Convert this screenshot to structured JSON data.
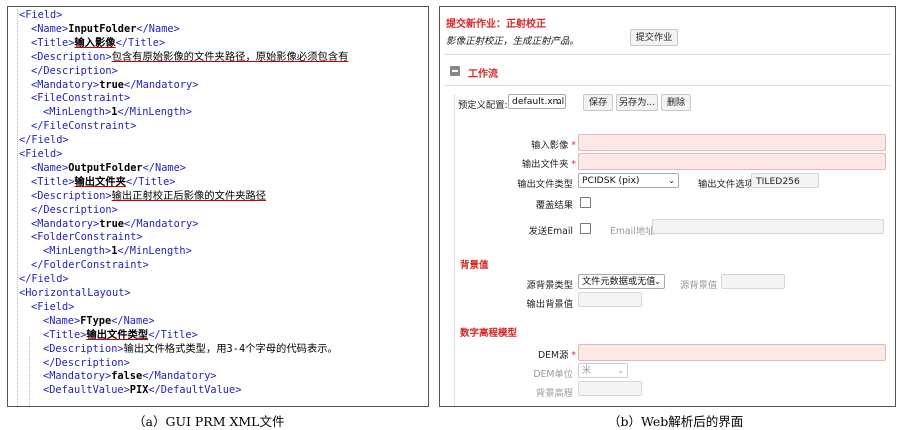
{
  "xml": {
    "lines": [
      {
        "indent": 0,
        "parts": [
          {
            "c": "tag",
            "t": "<Field>"
          }
        ]
      },
      {
        "indent": 1,
        "parts": [
          {
            "c": "tag",
            "t": "<Name>"
          },
          {
            "c": "val",
            "t": "InputFolder"
          },
          {
            "c": "tag",
            "t": "</Name>"
          }
        ]
      },
      {
        "indent": 1,
        "parts": [
          {
            "c": "tag",
            "t": "<Title>"
          },
          {
            "c": "val ul",
            "t": "输入影像"
          },
          {
            "c": "tag",
            "t": "</Title>"
          }
        ]
      },
      {
        "indent": 1,
        "parts": [
          {
            "c": "tag",
            "t": "<Description>"
          },
          {
            "c": "valn ul",
            "t": "包含有原始影像的文件夹路径，原始影像必须包含有"
          }
        ]
      },
      {
        "indent": 1,
        "parts": [
          {
            "c": "tag",
            "t": "</Description>"
          }
        ]
      },
      {
        "indent": 1,
        "parts": [
          {
            "c": "tag",
            "t": "<Mandatory>"
          },
          {
            "c": "val",
            "t": "true"
          },
          {
            "c": "tag",
            "t": "</Mandatory>"
          }
        ]
      },
      {
        "indent": 1,
        "parts": [
          {
            "c": "tag",
            "t": "<FileConstraint>"
          }
        ]
      },
      {
        "indent": 2,
        "parts": [
          {
            "c": "tag",
            "t": "<MinLength>"
          },
          {
            "c": "val",
            "t": "1"
          },
          {
            "c": "tag",
            "t": "</MinLength>"
          }
        ]
      },
      {
        "indent": 1,
        "parts": [
          {
            "c": "tag",
            "t": "</FileConstraint>"
          }
        ]
      },
      {
        "indent": 0,
        "parts": [
          {
            "c": "tag",
            "t": "</Field>"
          }
        ]
      },
      {
        "indent": 0,
        "parts": [
          {
            "c": "tag",
            "t": "<Field>"
          }
        ]
      },
      {
        "indent": 1,
        "parts": [
          {
            "c": "tag",
            "t": "<Name>"
          },
          {
            "c": "val",
            "t": "OutputFolder"
          },
          {
            "c": "tag",
            "t": "</Name>"
          }
        ]
      },
      {
        "indent": 1,
        "parts": [
          {
            "c": "tag",
            "t": "<Title>"
          },
          {
            "c": "val ul",
            "t": "输出文件夹"
          },
          {
            "c": "tag",
            "t": "</Title>"
          }
        ]
      },
      {
        "indent": 1,
        "parts": [
          {
            "c": "tag",
            "t": "<Description>"
          },
          {
            "c": "valn ul",
            "t": "输出正射校正后影像的文件夹路径"
          }
        ]
      },
      {
        "indent": 1,
        "parts": [
          {
            "c": "tag",
            "t": "</Description>"
          }
        ]
      },
      {
        "indent": 1,
        "parts": [
          {
            "c": "tag",
            "t": "<Mandatory>"
          },
          {
            "c": "val",
            "t": "true"
          },
          {
            "c": "tag",
            "t": "</Mandatory>"
          }
        ]
      },
      {
        "indent": 1,
        "parts": [
          {
            "c": "tag",
            "t": "<FolderConstraint>"
          }
        ]
      },
      {
        "indent": 2,
        "parts": [
          {
            "c": "tag",
            "t": "<MinLength>"
          },
          {
            "c": "val",
            "t": "1"
          },
          {
            "c": "tag",
            "t": "</MinLength>"
          }
        ]
      },
      {
        "indent": 1,
        "parts": [
          {
            "c": "tag",
            "t": "</FolderConstraint>"
          }
        ]
      },
      {
        "indent": 0,
        "parts": [
          {
            "c": "tag",
            "t": "</Field>"
          }
        ]
      },
      {
        "indent": 0,
        "parts": [
          {
            "c": "tag",
            "t": "<HorizontalLayout>"
          }
        ]
      },
      {
        "indent": 1,
        "parts": [
          {
            "c": "tag",
            "t": "<Field>"
          }
        ]
      },
      {
        "indent": 2,
        "parts": [
          {
            "c": "tag",
            "t": "<Name>"
          },
          {
            "c": "val",
            "t": "FType"
          },
          {
            "c": "tag",
            "t": "</Name>"
          }
        ]
      },
      {
        "indent": 2,
        "parts": [
          {
            "c": "tag",
            "t": "<Title>"
          },
          {
            "c": "val ul",
            "t": "输出文件类型"
          },
          {
            "c": "tag",
            "t": "</Title>"
          }
        ]
      },
      {
        "indent": 2,
        "parts": [
          {
            "c": "tag",
            "t": "<Description>"
          },
          {
            "c": "valn",
            "t": "输出文件格式类型，用3-4个字母的代码表示。"
          }
        ]
      },
      {
        "indent": 2,
        "parts": [
          {
            "c": "tag",
            "t": "</Description>"
          }
        ]
      },
      {
        "indent": 2,
        "parts": [
          {
            "c": "tag",
            "t": "<Mandatory>"
          },
          {
            "c": "val",
            "t": "false"
          },
          {
            "c": "tag",
            "t": "</Mandatory>"
          }
        ]
      },
      {
        "indent": 2,
        "parts": [
          {
            "c": "tag",
            "t": "<DefaultValue>"
          },
          {
            "c": "val",
            "t": "PIX"
          },
          {
            "c": "tag",
            "t": "</DefaultValue>"
          }
        ]
      }
    ]
  },
  "captions": {
    "left": "（a）GUI PRM XML文件",
    "right": "（b）Web解析后的界面"
  },
  "web": {
    "header_title": "提交新作业：正射校正",
    "header_desc": "影像正射校正，生成正射产品。",
    "submit_button": "提交作业",
    "workflow_section": "工作流",
    "collapse_icon": "minus-square-icon",
    "preset_label": "预定义配置:",
    "preset_value": "default.xml",
    "save_button": "保存",
    "save_as_button": "另存为...",
    "delete_button": "删除",
    "required_mark": "*",
    "fields": {
      "input_image_label": "输入影像",
      "output_folder_label": "输出文件夹",
      "output_type_label": "输出文件类型",
      "output_type_value": "PCIDSK (pix)",
      "output_option_label": "输出文件选项",
      "output_option_value": "TILED256",
      "overwrite_label": "覆盖结果",
      "send_email_label": "发送Email",
      "email_address_label": "Email地址"
    },
    "background_section": "背景值",
    "background": {
      "source_type_label": "源背景类型",
      "source_type_value": "文件元数据或无值",
      "source_value_label": "源背景值",
      "output_value_label": "输出背景值"
    },
    "dem_section": "数字高程模型",
    "dem": {
      "source_label": "DEM源",
      "unit_label": "DEM单位",
      "unit_value": "米",
      "background_elev_label": "背景高程"
    }
  }
}
